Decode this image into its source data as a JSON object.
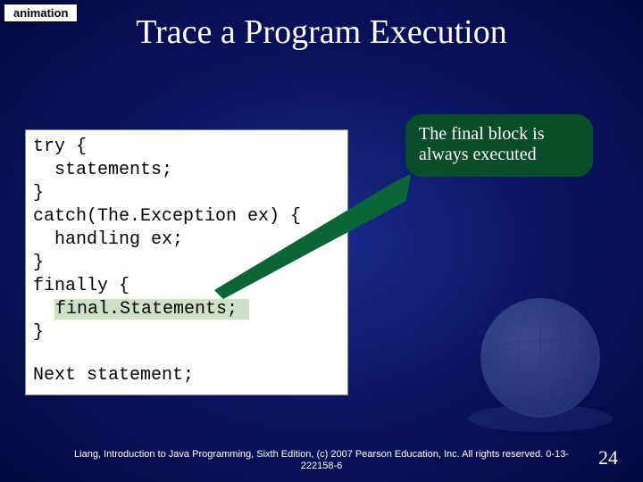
{
  "tag": "animation",
  "title": "Trace a Program Execution",
  "code": {
    "l1": "try {",
    "l2": "statements;",
    "l3": "}",
    "l4": "catch(The.Exception ex) {",
    "l5": "handling ex;",
    "l6": "}",
    "l7": "finally {",
    "l8": "final.Statements; ",
    "l9": "}",
    "l10": "Next statement;"
  },
  "callout": "The final block is always executed",
  "footer": "Liang, Introduction to Java Programming, Sixth Edition, (c) 2007 Pearson Education, Inc. All rights reserved. 0-13-222158-6",
  "page": "24"
}
